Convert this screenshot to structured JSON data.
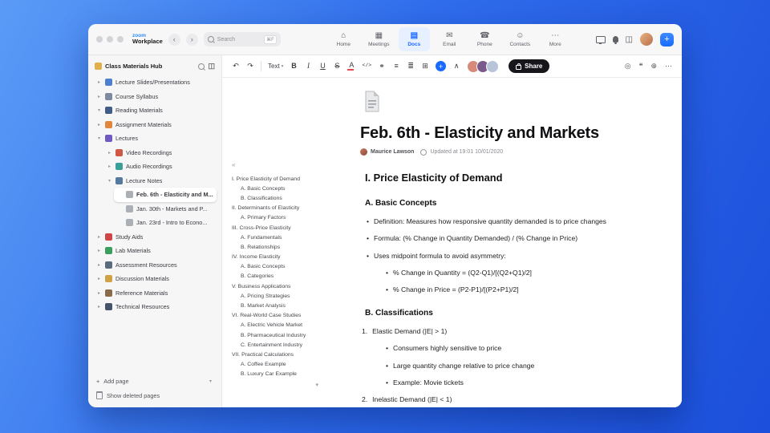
{
  "titlebar": {
    "logo_top": "zoom",
    "logo_bottom": "Workplace",
    "back": "‹",
    "forward": "›",
    "search_label": "Search",
    "search_shortcut": "⌘F",
    "tabs": [
      {
        "label": "Home",
        "icon": "home-icon",
        "glyph": "⌂"
      },
      {
        "label": "Meetings",
        "icon": "meetings-icon",
        "glyph": "▦"
      },
      {
        "label": "Docs",
        "icon": "docs-icon",
        "glyph": "▤",
        "active": true
      },
      {
        "label": "Email",
        "icon": "email-icon",
        "glyph": "✉"
      },
      {
        "label": "Phone",
        "icon": "phone-icon",
        "glyph": "☎"
      },
      {
        "label": "Contacts",
        "icon": "contacts-icon",
        "glyph": "☺"
      },
      {
        "label": "More",
        "icon": "more-icon",
        "glyph": "⋯"
      }
    ]
  },
  "sidebar": {
    "title": "Class Materials Hub",
    "items": [
      {
        "label": "Lecture Slides/Presentations",
        "icon": "presentation-icon",
        "color": "#4d7fd0",
        "chev": "▸",
        "level": 0
      },
      {
        "label": "Course Syllabus",
        "icon": "syllabus-icon",
        "color": "#7d8aa0",
        "chev": "▸",
        "level": 0
      },
      {
        "label": "Reading Materials",
        "icon": "book-icon",
        "color": "#3f5d85",
        "chev": "▾",
        "level": 0
      },
      {
        "label": "Assignment Materials",
        "icon": "assignment-icon",
        "color": "#e0873c",
        "chev": "▸",
        "level": 0
      },
      {
        "label": "Lectures",
        "icon": "lectures-icon",
        "color": "#6f5bc0",
        "chev": "▾",
        "level": 0
      },
      {
        "label": "Video Recordings",
        "icon": "video-icon",
        "color": "#d05745",
        "chev": "▸",
        "level": 1
      },
      {
        "label": "Audio Recordings",
        "icon": "audio-icon",
        "color": "#3a9e98",
        "chev": "▸",
        "level": 1
      },
      {
        "label": "Lecture Notes",
        "icon": "notes-icon",
        "color": "#567a9e",
        "chev": "▾",
        "level": 1
      },
      {
        "label": "Feb. 6th - Elasticity and M...",
        "icon": "page-icon",
        "color": "#aab0b6",
        "chev": "",
        "level": 2,
        "selected": true
      },
      {
        "label": "Jan. 30th - Markets and P...",
        "icon": "page-icon",
        "color": "#aab0b6",
        "chev": "",
        "level": 2
      },
      {
        "label": "Jan. 23rd - Intro to Econo...",
        "icon": "page-icon",
        "color": "#aab0b6",
        "chev": "",
        "level": 2
      },
      {
        "label": "Study Aids",
        "icon": "heart-icon",
        "color": "#d04545",
        "chev": "▸",
        "level": 0
      },
      {
        "label": "Lab Materials",
        "icon": "lab-icon",
        "color": "#3a9e5c",
        "chev": "▸",
        "level": 0
      },
      {
        "label": "Assessment Resources",
        "icon": "assessment-icon",
        "color": "#5b6b7e",
        "chev": "▸",
        "level": 0
      },
      {
        "label": "Discussion Materials",
        "icon": "discussion-icon",
        "color": "#d0a245",
        "chev": "▸",
        "level": 0
      },
      {
        "label": "Reference Materials",
        "icon": "reference-icon",
        "color": "#8a6a4a",
        "chev": "▸",
        "level": 0
      },
      {
        "label": "Technical Resources",
        "icon": "tech-icon",
        "color": "#47536b",
        "chev": "▸",
        "level": 0
      }
    ],
    "add_page": "Add page",
    "add_page_plus": "+",
    "add_page_chev": "▾",
    "show_deleted": "Show deleted pages"
  },
  "toolbar": {
    "undo": "↶",
    "redo": "↷",
    "text_style": "Text",
    "dropdown_chev": "▾",
    "bold": "B",
    "italic": "I",
    "underline": "U",
    "strike": "S",
    "color": "A",
    "code": "</>",
    "link": "⚭",
    "bullet_list": "≡",
    "align": "≣",
    "insert_grid": "⊞",
    "plus": "+",
    "collapse": "∧",
    "avatars": [
      {
        "icon": "collaborator-avatar",
        "color": "#d88a7a"
      },
      {
        "icon": "collaborator-avatar",
        "color": "#7a5a8a"
      },
      {
        "icon": "collaborator-avatar",
        "color": "#b8c4d8"
      }
    ],
    "share_label": "Share",
    "camera": "◎",
    "comment": "❝",
    "globe": "⊕",
    "more": "⋯"
  },
  "outline": {
    "collapse": "«",
    "scroll_down": "▾",
    "items": [
      {
        "text": "I. Price Elasticity of Demand",
        "level": 0
      },
      {
        "text": "A. Basic Concepts",
        "level": 1
      },
      {
        "text": "B. Classifications",
        "level": 1
      },
      {
        "text": "II. Determinants of Elasticity",
        "level": 0
      },
      {
        "text": "A. Primary Factors",
        "level": 1
      },
      {
        "text": "III. Cross-Price Elasticity",
        "level": 0
      },
      {
        "text": "A. Fundamentals",
        "level": 1
      },
      {
        "text": "B. Relationships",
        "level": 1
      },
      {
        "text": "IV. Income Elasticity",
        "level": 0
      },
      {
        "text": "A. Basic Concepts",
        "level": 1
      },
      {
        "text": "B. Categories",
        "level": 1
      },
      {
        "text": "V. Business Applications",
        "level": 0
      },
      {
        "text": "A. Pricing Strategies",
        "level": 1
      },
      {
        "text": "B. Market Analysis",
        "level": 1
      },
      {
        "text": "VI. Real-World Case Studies",
        "level": 0
      },
      {
        "text": "A. Electric Vehicle Market",
        "level": 1
      },
      {
        "text": "B. Pharmaceutical Industry",
        "level": 1
      },
      {
        "text": "C. Entertainment Industry",
        "level": 1
      },
      {
        "text": "VII. Practical Calculations",
        "level": 0
      },
      {
        "text": "A. Coffee Example",
        "level": 1
      },
      {
        "text": "B. Luxury Car Example",
        "level": 1
      }
    ]
  },
  "doc": {
    "title": "Feb. 6th - Elasticity and Markets",
    "author": "Maurice Lawson",
    "updated": "Updated at 19:01 10/01/2020",
    "blocks": [
      {
        "type": "h1",
        "text": "I. Price Elasticity of Demand"
      },
      {
        "type": "h2",
        "text": "A. Basic Concepts"
      },
      {
        "type": "bullet",
        "level": 0,
        "marker": "•",
        "text": "Definition: Measures how responsive quantity demanded is to price changes"
      },
      {
        "type": "bullet",
        "level": 0,
        "marker": "•",
        "text": "Formula: (% Change in Quantity Demanded) / (% Change in Price)"
      },
      {
        "type": "bullet",
        "level": 0,
        "marker": "•",
        "text": "Uses midpoint formula to avoid asymmetry:"
      },
      {
        "type": "bullet",
        "level": 1,
        "marker": "•",
        "text": "% Change in Quantity = (Q2-Q1)/[(Q2+Q1)/2]"
      },
      {
        "type": "bullet",
        "level": 1,
        "marker": "•",
        "text": "% Change in Price = (P2-P1)/[(P2+P1)/2]"
      },
      {
        "type": "h2",
        "text": "B. Classifications"
      },
      {
        "type": "num",
        "level": 0,
        "marker": "1.",
        "text": "Elastic Demand (|E| > 1)"
      },
      {
        "type": "bullet",
        "level": 1,
        "marker": "•",
        "text": "Consumers highly sensitive to price"
      },
      {
        "type": "bullet",
        "level": 1,
        "marker": "•",
        "text": "Large quantity change relative to price change"
      },
      {
        "type": "bullet",
        "level": 1,
        "marker": "•",
        "text": "Example: Movie tickets"
      },
      {
        "type": "num",
        "level": 0,
        "marker": "2.",
        "text": "Inelastic Demand (|E| < 1)"
      }
    ]
  }
}
